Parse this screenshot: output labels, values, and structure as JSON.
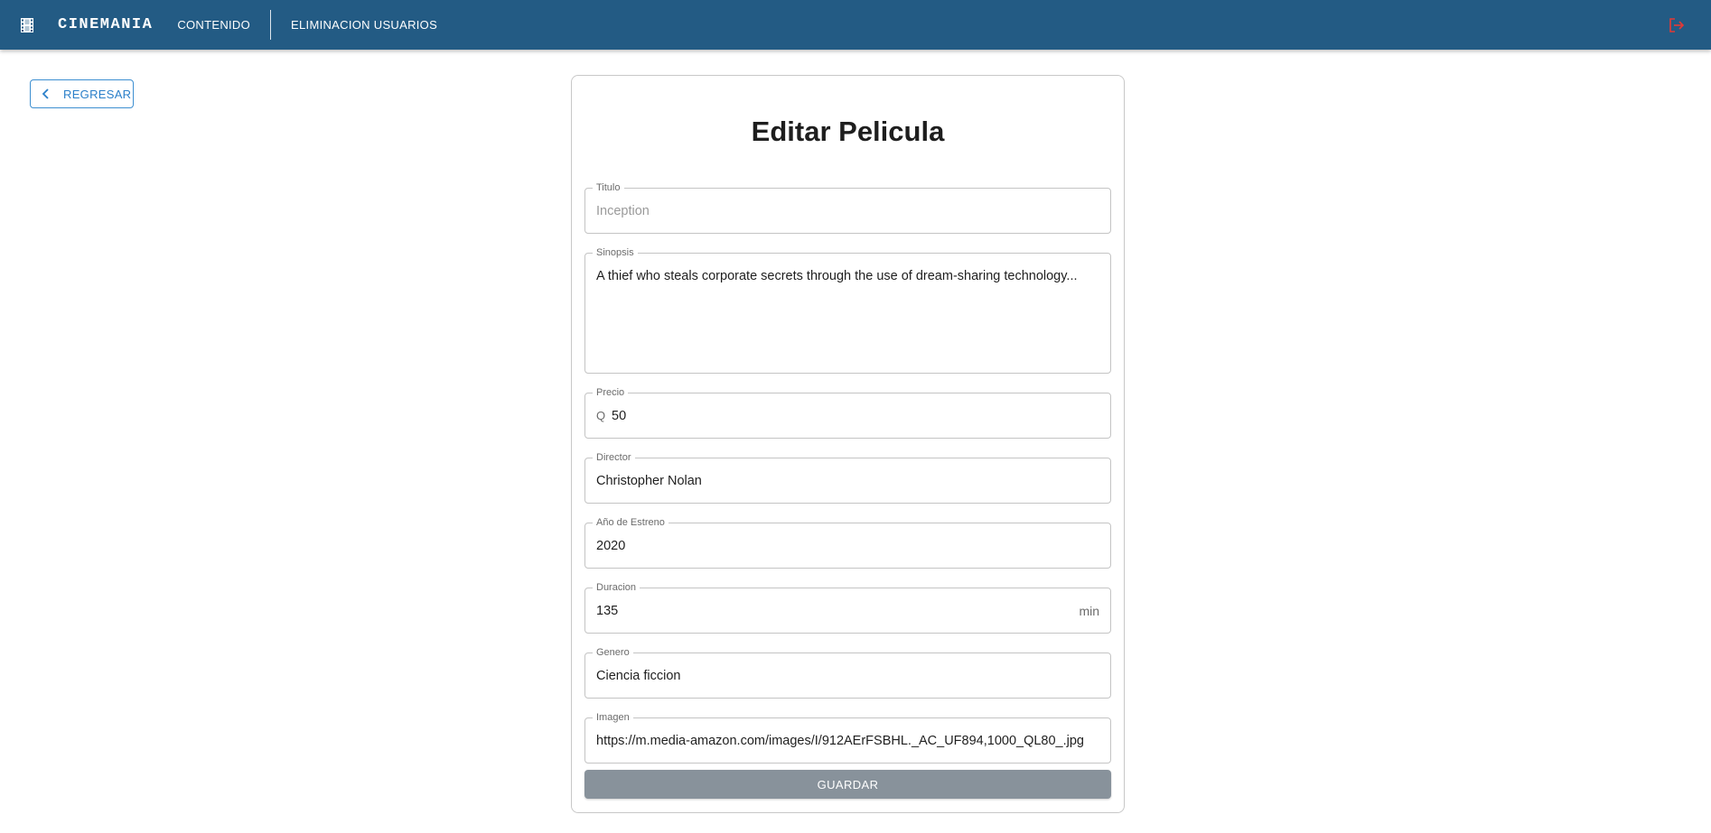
{
  "header": {
    "brand": "CINEMANIA",
    "nav": {
      "contenido": "CONTENIDO",
      "eliminacion": "ELIMINACION USUARIOS"
    },
    "icons": {
      "film": "film-icon",
      "logout": "logout-icon"
    },
    "colors": {
      "bar": "#235b84",
      "logout": "#e53935"
    }
  },
  "back": {
    "label": "REGRESAR"
  },
  "form": {
    "title": "Editar Pelicula",
    "fields": {
      "titulo": {
        "label": "Titulo",
        "placeholder": "Inception"
      },
      "sinopsis": {
        "label": "Sinopsis",
        "value": "A thief who steals corporate secrets through the use of dream-sharing technology..."
      },
      "precio": {
        "label": "Precio",
        "prefix": "Q",
        "value": "50"
      },
      "director": {
        "label": "Director",
        "value": "Christopher Nolan"
      },
      "anio": {
        "label": "Año de Estreno",
        "value": "2020"
      },
      "duracion": {
        "label": "Duracion",
        "value": "135",
        "suffix": "min"
      },
      "genero": {
        "label": "Genero",
        "value": "Ciencia ficcion"
      },
      "imagen": {
        "label": "Imagen",
        "value": "https://m.media-amazon.com/images/I/912AErFSBHL._AC_UF894,1000_QL80_.jpg"
      }
    },
    "save_label": "GUARDAR",
    "colors": {
      "save_button": "#88929b",
      "back_accent": "#2a7fc9"
    }
  }
}
